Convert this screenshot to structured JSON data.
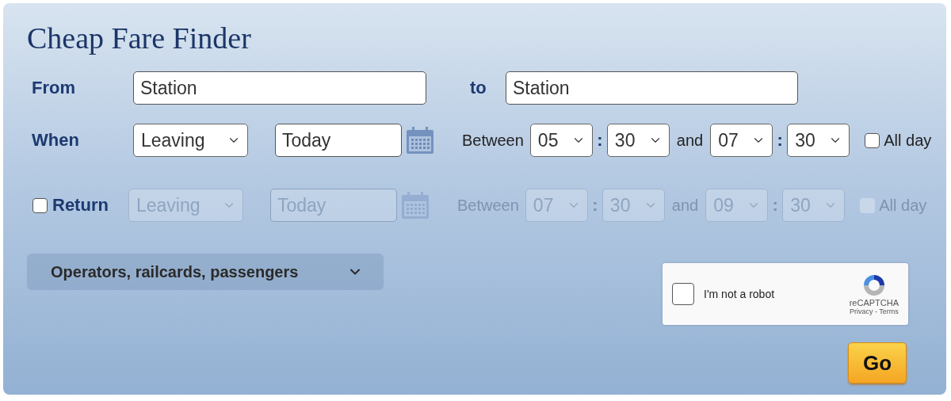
{
  "title": "Cheap Fare Finder",
  "from": {
    "label": "From",
    "value": "Station"
  },
  "to": {
    "label": "to",
    "value": "Station"
  },
  "journeys": [
    {
      "kind": "outward",
      "label": "When",
      "disabled": false,
      "mode": "Leaving",
      "date": "Today",
      "between_label": "Between",
      "from_hour": "05",
      "from_minute": "30",
      "and_label": "and",
      "to_hour": "07",
      "to_minute": "30",
      "separators": [
        ":",
        ":"
      ],
      "all_day": {
        "label": "All day",
        "checked": false
      }
    },
    {
      "kind": "return",
      "label": "Return",
      "checked": false,
      "disabled": true,
      "mode": "Leaving",
      "date": "Today",
      "between_label": "Between",
      "from_hour": "07",
      "from_minute": "30",
      "and_label": "and",
      "to_hour": "09",
      "to_minute": "30",
      "separators": [
        ":",
        ":"
      ],
      "all_day": {
        "label": "All day",
        "checked": false
      }
    }
  ],
  "options": {
    "label": "Operators, railcards, passengers",
    "expanded": false
  },
  "captcha": {
    "label": "I'm not a robot",
    "checked": false,
    "brand": "reCAPTCHA",
    "links": "Privacy - Terms"
  },
  "go": "Go"
}
